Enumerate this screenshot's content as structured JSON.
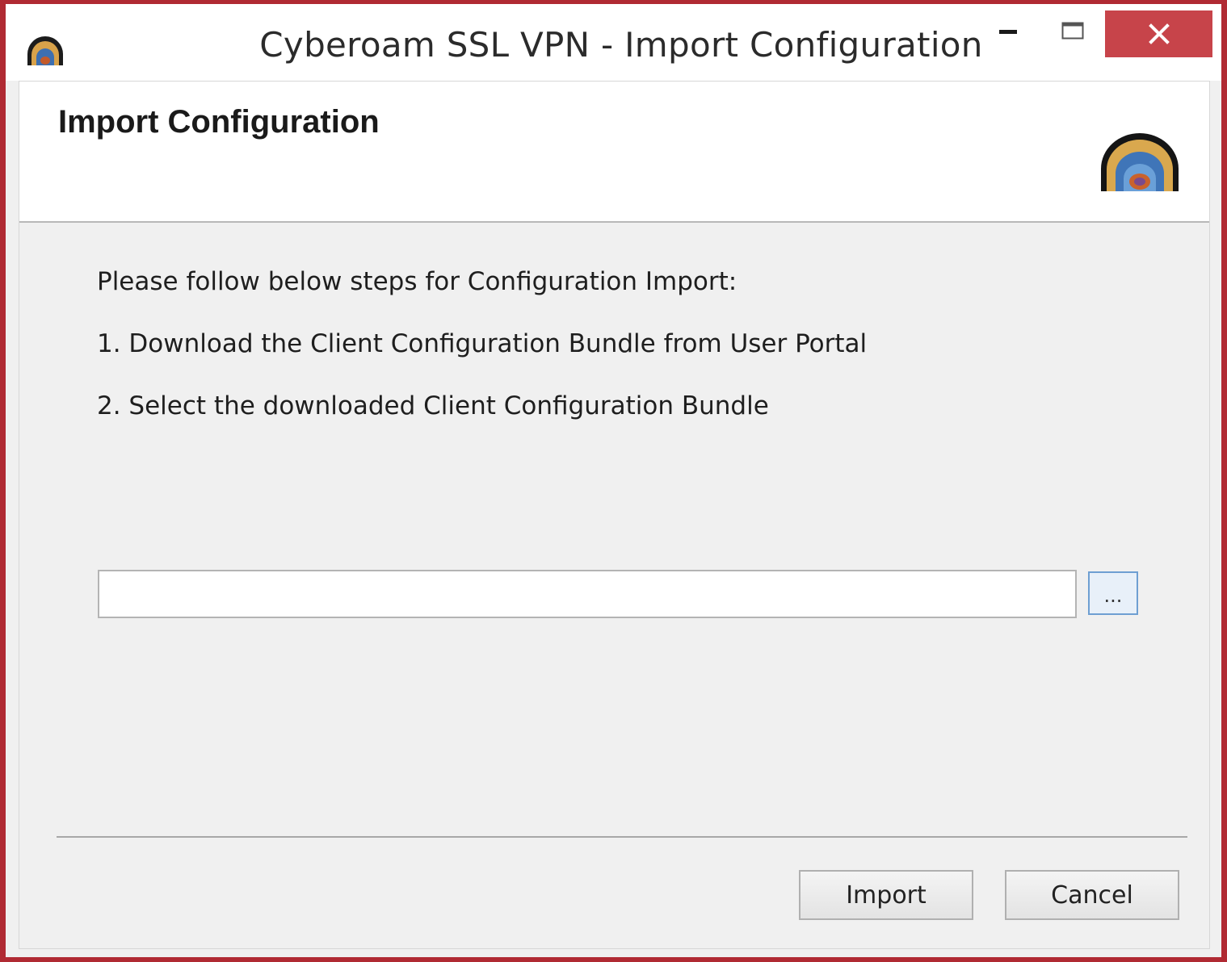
{
  "window": {
    "title": "Cyberoam SSL VPN - Import Configuration",
    "controls": {
      "minimize_icon": "minimize-icon",
      "maximize_icon": "maximize-icon",
      "close_icon": "close-icon"
    },
    "accent_color": "#b02a33",
    "close_button_color": "#c7444a"
  },
  "header": {
    "title": "Import Configuration",
    "logo_icon": "cyberoam-logo-icon"
  },
  "instructions": {
    "intro": "Please follow below steps for Configuration Import:",
    "step1": "1. Download the Client Configuration Bundle from User Portal",
    "step2": "2. Select the downloaded Client Configuration Bundle"
  },
  "file_picker": {
    "value": "",
    "placeholder": "",
    "browse_label": "..."
  },
  "buttons": {
    "import_label": "Import",
    "cancel_label": "Cancel"
  }
}
